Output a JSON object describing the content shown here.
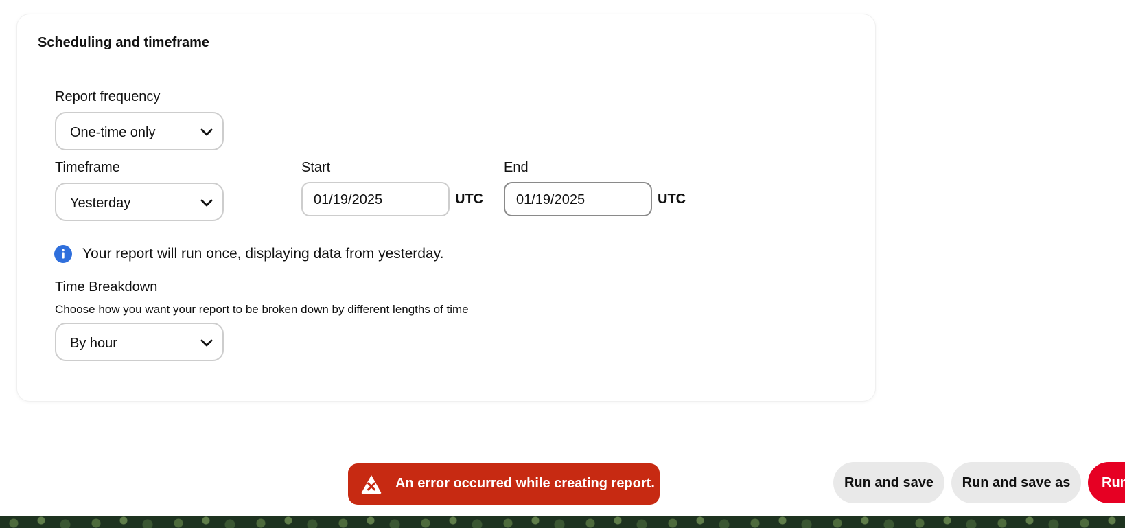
{
  "section": {
    "title": "Scheduling and timeframe",
    "report_frequency": {
      "label": "Report frequency",
      "value": "One-time only"
    },
    "timeframe": {
      "label": "Timeframe",
      "value": "Yesterday"
    },
    "start": {
      "label": "Start",
      "value": "01/19/2025",
      "tz": "UTC"
    },
    "end": {
      "label": "End",
      "value": "01/19/2025",
      "tz": "UTC"
    },
    "info_message": "Your report will run once, displaying data from yesterday.",
    "time_breakdown": {
      "label": "Time Breakdown",
      "hint": "Choose how you want your report to be broken down by different lengths of time",
      "value": "By hour"
    }
  },
  "toast": {
    "message": "An error occurred while creating report."
  },
  "actions": {
    "run_and_save": "Run and save",
    "run_and_save_as": "Run and save as",
    "run": "Run"
  },
  "colors": {
    "error": "#c72a12",
    "primary": "#e60023",
    "info": "#2f6fdc"
  }
}
